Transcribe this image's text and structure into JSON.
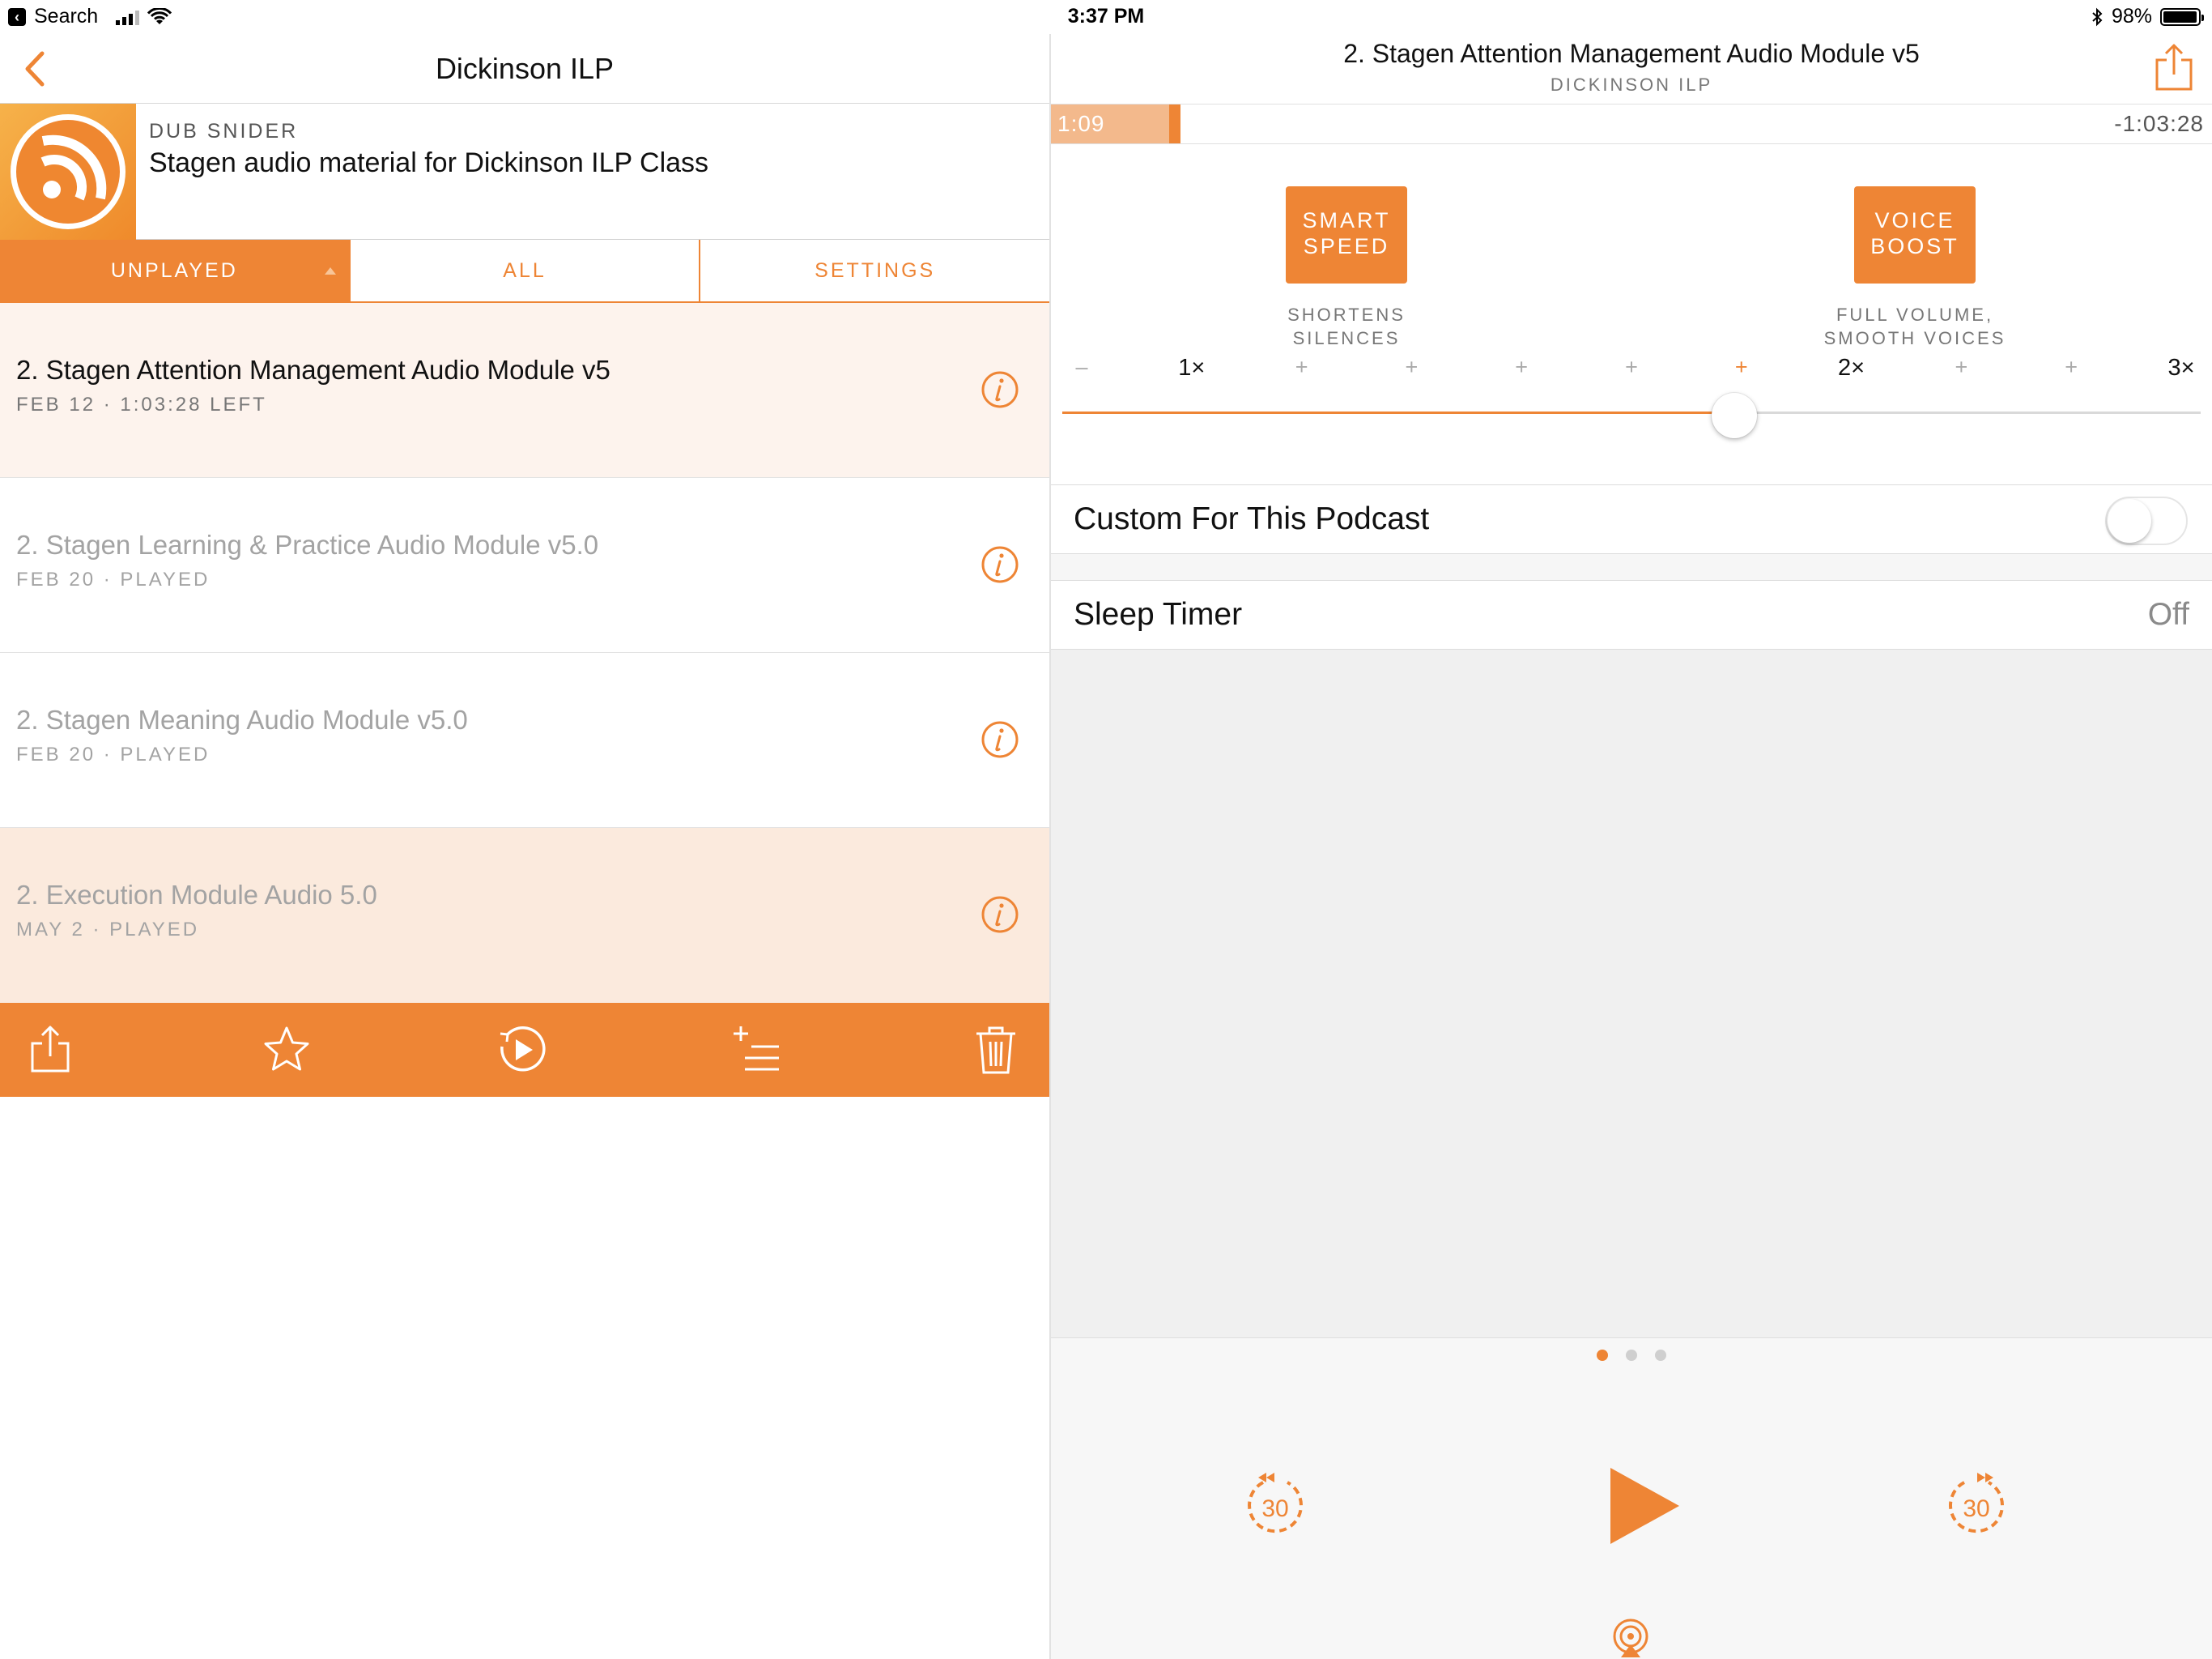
{
  "status_bar": {
    "back_app": "Search",
    "time": "3:37 PM",
    "battery": "98%",
    "battery_level": 0.98
  },
  "left": {
    "nav_title": "Dickinson ILP",
    "podcast": {
      "author": "DUB SNIDER",
      "description": "Stagen audio material for Dickinson ILP Class",
      "artwork_icon": "rss-icon"
    },
    "segments": [
      {
        "label": "UNPLAYED",
        "active": true
      },
      {
        "label": "ALL",
        "active": false
      },
      {
        "label": "SETTINGS",
        "active": false
      }
    ],
    "episodes": [
      {
        "title": "2. Stagen Attention Management Audio Module v5",
        "meta": "FEB 12 · 1:03:28 LEFT",
        "played": false
      },
      {
        "title": "2. Stagen Learning & Practice Audio Module v5.0",
        "meta": "FEB 20 · PLAYED",
        "played": true
      },
      {
        "title": "2. Stagen Meaning Audio Module v5.0",
        "meta": "FEB 20 · PLAYED",
        "played": true
      },
      {
        "title": "2. Execution Module Audio 5.0",
        "meta": "MAY 2 · PLAYED",
        "played": true
      }
    ],
    "action_bar": [
      "share-icon",
      "star-icon",
      "play-next-icon",
      "add-to-queue-icon",
      "trash-icon"
    ]
  },
  "player": {
    "title": "2. Stagen Attention Management Audio Module v5",
    "subtitle": "DICKINSON ILP",
    "elapsed": "1:09",
    "remaining": "-1:03:28",
    "progress": 0.018,
    "effects": [
      {
        "label_line1": "SMART",
        "label_line2": "SPEED",
        "caption_line1": "SHORTENS",
        "caption_line2": "SILENCES"
      },
      {
        "label_line1": "VOICE",
        "label_line2": "BOOST",
        "caption_line1": "FULL VOLUME,",
        "caption_line2": "SMOOTH VOICES"
      }
    ],
    "speed": {
      "ticks": [
        "–",
        "1×",
        "+",
        "+",
        "+",
        "+",
        "+",
        "2×",
        "+",
        "+",
        "3×"
      ],
      "value_fraction": 0.59
    },
    "custom_label": "Custom For This Podcast",
    "custom_on": false,
    "sleep_label": "Sleep Timer",
    "sleep_value": "Off",
    "skip_back": "30",
    "skip_forward": "30",
    "accent": "#EE8535"
  }
}
